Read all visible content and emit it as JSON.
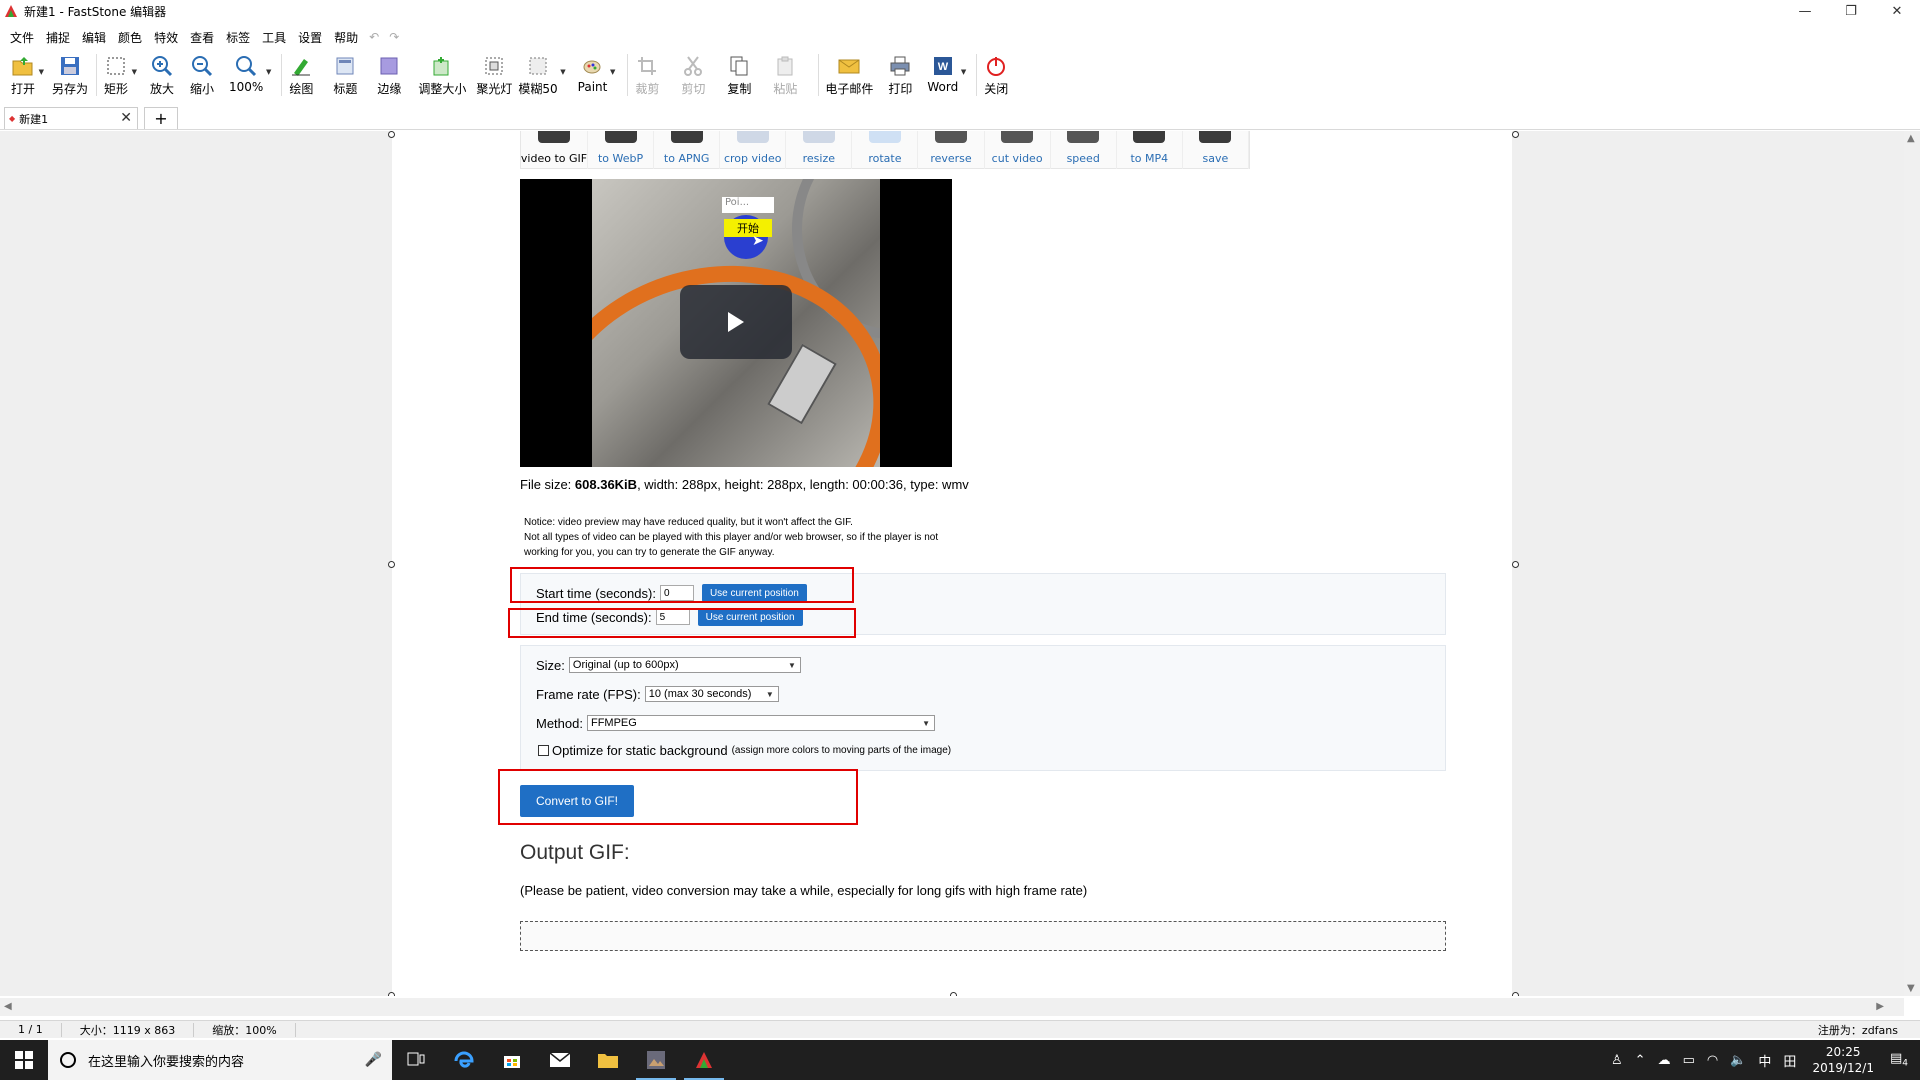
{
  "window": {
    "title": "新建1 - FastStone 编辑器",
    "controls": [
      "—",
      "❐",
      "✕"
    ]
  },
  "menu": {
    "items": [
      "文件",
      "捕捉",
      "编辑",
      "颜色",
      "特效",
      "查看",
      "标签",
      "工具",
      "设置",
      "帮助"
    ]
  },
  "toolbar": {
    "items": [
      {
        "label": "打开",
        "icon": "folder-open-icon"
      },
      {
        "label": "另存为",
        "icon": "save-icon"
      },
      {
        "label": "矩形",
        "icon": "rect-select-icon"
      },
      {
        "label": "放大",
        "icon": "zoom-in-icon"
      },
      {
        "label": "缩小",
        "icon": "zoom-out-icon"
      },
      {
        "label": "100%",
        "icon": "zoom-100-icon"
      },
      {
        "label": "绘图",
        "icon": "draw-icon"
      },
      {
        "label": "标题",
        "icon": "caption-icon"
      },
      {
        "label": "边缘",
        "icon": "edge-icon"
      },
      {
        "label": "调整大小",
        "icon": "resize-icon"
      },
      {
        "label": "聚光灯",
        "icon": "spotlight-icon"
      },
      {
        "label": "模糊50",
        "icon": "blur-icon"
      },
      {
        "label": "Paint",
        "icon": "paint-icon"
      },
      {
        "label": "裁剪",
        "icon": "crop-icon"
      },
      {
        "label": "剪切",
        "icon": "cut-icon"
      },
      {
        "label": "复制",
        "icon": "copy-icon"
      },
      {
        "label": "粘贴",
        "icon": "paste-icon"
      },
      {
        "label": "电子邮件",
        "icon": "email-icon"
      },
      {
        "label": "打印",
        "icon": "print-icon"
      },
      {
        "label": "Word",
        "icon": "word-icon"
      },
      {
        "label": "关闭",
        "icon": "power-icon"
      }
    ]
  },
  "tabs": {
    "doc_name": "新建1",
    "close": "✕",
    "add": "+"
  },
  "web": {
    "video_tools": [
      "video to GIF",
      "to WebP",
      "to APNG",
      "crop video",
      "resize",
      "rotate",
      "reverse",
      "cut video",
      "speed",
      "to MP4",
      "save"
    ],
    "player": {
      "popup_text": "Poi...",
      "start_label": "开始"
    },
    "fileinfo": {
      "prefix": "File size: ",
      "size": "608.36KiB",
      "rest": ", width: 288px, height: 288px, length: 00:00:36, type: wmv"
    },
    "notice": {
      "line1": "Notice: video preview may have reduced quality, but it won't affect the GIF.",
      "line2": "Not all types of video can be played with this player and/or web browser, so if the player is not",
      "line3": "working for you, you can try to generate the GIF anyway."
    },
    "start_time": {
      "label": "Start time (seconds):",
      "value": "0",
      "button": "Use current position"
    },
    "end_time": {
      "label": "End time (seconds):",
      "value": "5",
      "button": "Use current position"
    },
    "size": {
      "label": "Size:",
      "value": "Original (up to 600px)"
    },
    "fps": {
      "label": "Frame rate (FPS):",
      "value": "10 (max 30 seconds)"
    },
    "method": {
      "label": "Method:",
      "value": "FFMPEG"
    },
    "optimize": {
      "label": "Optimize for static background",
      "hint": "(assign more colors to moving parts of the image)"
    },
    "convert_button": "Convert to GIF!",
    "output_title": "Output GIF:",
    "output_note": "(Please be patient, video conversion may take a while, especially for long gifs with high frame rate)"
  },
  "statusbar": {
    "page": "1 / 1",
    "size": "大小：1119 x 863",
    "zoom": "缩放：100%",
    "registered": "注册为：zdfans"
  },
  "taskbar": {
    "search_placeholder": "在这里输入你要搜索的内容",
    "time": "20:25",
    "date": "2019/12/1",
    "ime": "中",
    "notifications": "4"
  },
  "colors": {
    "accent_blue": "#1f6fc5",
    "highlight_red": "#e00000",
    "link_blue": "#2a6db3"
  }
}
